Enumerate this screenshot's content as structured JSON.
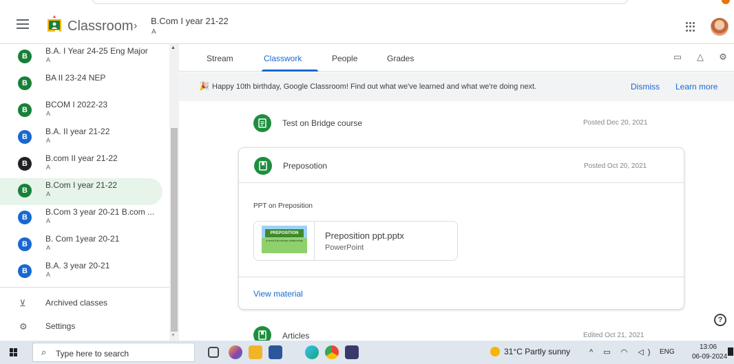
{
  "header": {
    "app_title": "Classroom",
    "breadcrumb_separator": "›",
    "class_title": "B.Com I year 21-22",
    "class_section": "A"
  },
  "sidebar": {
    "classes": [
      {
        "initial": "B",
        "name": "B.A. I Year 24-25 Eng Major",
        "section": "A",
        "color": "#188038"
      },
      {
        "initial": "B",
        "name": "BA II 23-24 NEP",
        "section": "",
        "color": "#188038"
      },
      {
        "initial": "B",
        "name": "BCOM I 2022-23",
        "section": "A",
        "color": "#188038"
      },
      {
        "initial": "B",
        "name": "B.A. II year 21-22",
        "section": "A",
        "color": "#1967d2"
      },
      {
        "initial": "B",
        "name": "B.com II year 21-22",
        "section": "A",
        "color": "#202124"
      },
      {
        "initial": "B",
        "name": "B.Com I year 21-22",
        "section": "A",
        "color": "#188038"
      },
      {
        "initial": "B",
        "name": "B.Com 3 year 20-21 B.com ...",
        "section": "A",
        "color": "#1967d2"
      },
      {
        "initial": "B",
        "name": "B. Com 1year 20-21",
        "section": "A",
        "color": "#1967d2"
      },
      {
        "initial": "B",
        "name": "B.A. 3 year 20-21",
        "section": "A",
        "color": "#1967d2"
      }
    ],
    "archived_label": "Archived classes",
    "settings_label": "Settings"
  },
  "tabs": [
    {
      "label": "Stream"
    },
    {
      "label": "Classwork"
    },
    {
      "label": "People"
    },
    {
      "label": "Grades"
    }
  ],
  "banner": {
    "text": "Happy 10th birthday, Google Classroom! Find out what we've learned and what we're doing next.",
    "dismiss": "Dismiss",
    "learn_more": "Learn more"
  },
  "posts": [
    {
      "title": "Test on Bridge course",
      "date": "Posted Dec 20, 2021"
    },
    {
      "title": "Preposotion",
      "date": "Posted Oct 20, 2021"
    },
    {
      "title": "Articles",
      "date": "Edited Oct 21, 2021"
    }
  ],
  "card": {
    "description": "PPT on Preposition",
    "attachment_name": "Preposition ppt.pptx",
    "attachment_type": "PowerPoint",
    "thumb_title": "PREPOSITION",
    "thumb_sub": "a word that shows relationship",
    "view_material": "View material"
  },
  "help": "?",
  "taskbar": {
    "search_placeholder": "Type here to search",
    "weather": "31°C  Partly sunny",
    "tray": "^ ▭ ◠ ◁)",
    "language": "ENG",
    "time": "13:06",
    "date": "06-09-2024"
  }
}
